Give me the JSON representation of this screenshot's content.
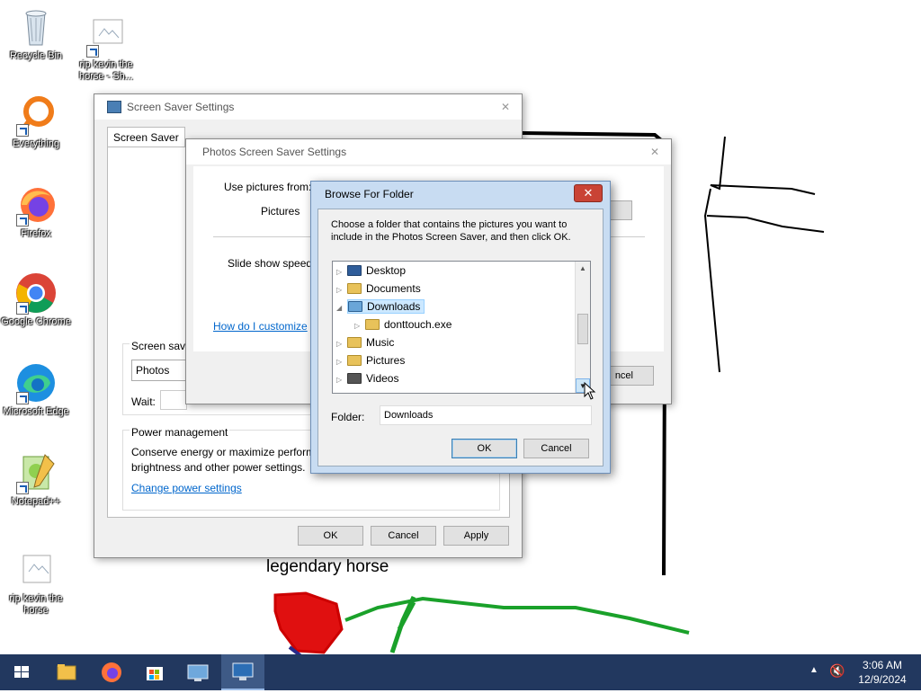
{
  "desktop": {
    "icons": [
      {
        "label": "Recycle Bin",
        "icon": "recycle-bin-icon"
      },
      {
        "label": "rip kevin the horse - Sh...",
        "icon": "image-file-icon"
      },
      {
        "label": "Everything",
        "icon": "everything-icon"
      },
      {
        "label": "Firefox",
        "icon": "firefox-icon"
      },
      {
        "label": "Google Chrome",
        "icon": "chrome-icon"
      },
      {
        "label": "Microsoft Edge",
        "icon": "edge-icon"
      },
      {
        "label": "Notepad++",
        "icon": "notepadpp-icon"
      },
      {
        "label": "rip kevin the horse",
        "icon": "image-file-icon"
      }
    ],
    "drawing_caption": "legendary horse"
  },
  "screen_saver_window": {
    "title": "Screen Saver Settings",
    "tab": "Screen Saver",
    "screen_saver_label": "Screen save",
    "selected_saver": "Photos",
    "wait_label": "Wait:",
    "power_group_label": "Power management",
    "power_text_1": "Conserve energy or maximize perform",
    "power_text_2": "brightness and other power settings.",
    "power_link": "Change power settings",
    "ok": "OK",
    "cancel": "Cancel",
    "apply": "Apply"
  },
  "photos_window": {
    "title": "Photos Screen Saver Settings",
    "use_pictures_label": "Use pictures from:",
    "pictures_label": "Pictures",
    "slide_speed_label": "Slide show speed:",
    "customize_link": "How do I customize",
    "cancel_partial": "ncel"
  },
  "browse_dialog": {
    "title": "Browse For Folder",
    "instructions_1": "Choose a folder that contains the pictures you want to",
    "instructions_2": "include in the Photos Screen Saver, and then click OK.",
    "tree": [
      {
        "label": "Desktop",
        "level": 0,
        "expander": "▷"
      },
      {
        "label": "Documents",
        "level": 0,
        "expander": "▷"
      },
      {
        "label": "Downloads",
        "level": 0,
        "expander": "◢",
        "selected": true
      },
      {
        "label": "donttouch.exe",
        "level": 1,
        "expander": "▷"
      },
      {
        "label": "Music",
        "level": 0,
        "expander": "▷"
      },
      {
        "label": "Pictures",
        "level": 0,
        "expander": "▷"
      },
      {
        "label": "Videos",
        "level": 0,
        "expander": "▷"
      }
    ],
    "folder_label": "Folder:",
    "folder_value": "Downloads",
    "ok": "OK",
    "cancel": "Cancel",
    "close_glyph": "✕"
  },
  "taskbar": {
    "time": "3:06 AM",
    "date": "12/9/2024",
    "colors": {
      "bar": "#22385f"
    }
  }
}
